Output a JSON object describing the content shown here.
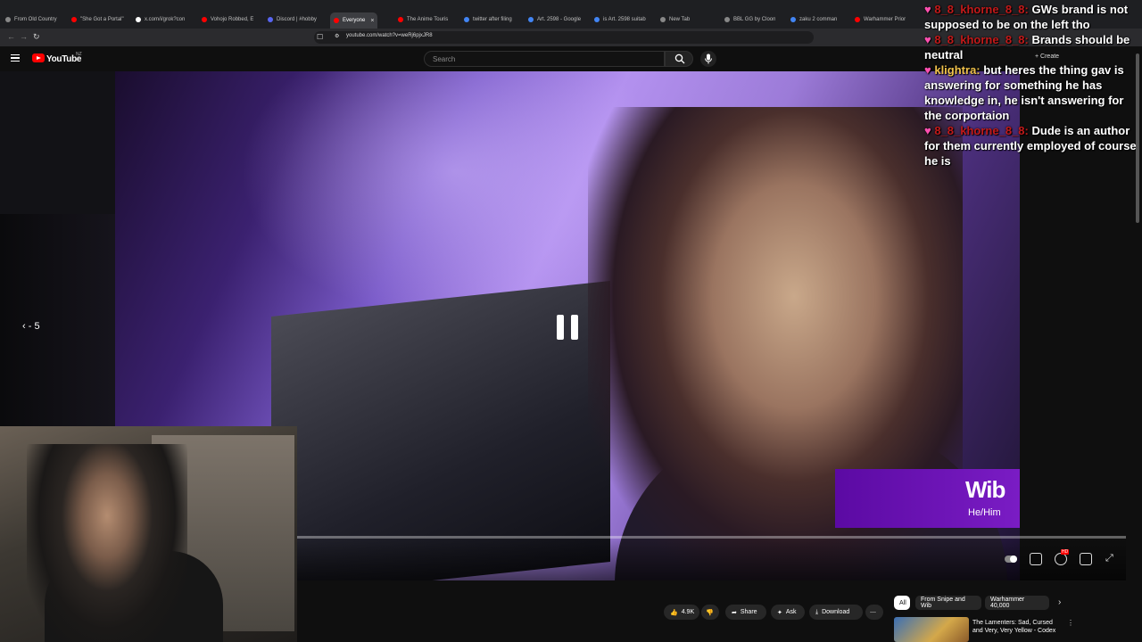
{
  "browser": {
    "tabs": [
      {
        "label": "From Old Country",
        "color": "#888888"
      },
      {
        "label": "\"She Got a Portal\"",
        "color": "#ff0000"
      },
      {
        "label": "x.com/i/grok?con",
        "color": "#ffffff"
      },
      {
        "label": "Vohojo Robbed, E",
        "color": "#ff0000"
      },
      {
        "label": "Discord | #hobby",
        "color": "#5865f2"
      },
      {
        "label": "Everyone",
        "color": "#ff0000",
        "active": true
      },
      {
        "label": "The Anime Touris",
        "color": "#ff0000"
      },
      {
        "label": "twitter after filing",
        "color": "#4285f4"
      },
      {
        "label": "Art. 2598 - Google",
        "color": "#4285f4"
      },
      {
        "label": "is Art. 2598 suitab",
        "color": "#4285f4"
      },
      {
        "label": "New Tab",
        "color": "#888888"
      },
      {
        "label": "BBL GG by Cloon",
        "color": "#888888"
      },
      {
        "label": "zaku 2 comman",
        "color": "#4285f4"
      },
      {
        "label": "Warhammer Prior",
        "color": "#ff0000"
      }
    ],
    "url": "youtube.com/watch?v=weRj6pjxJR8"
  },
  "header": {
    "wordmark": "YouTube",
    "country": "NZ",
    "search_placeholder": "Search",
    "create_label": "Create"
  },
  "player": {
    "seek_label": "- 5",
    "nameplate_name": "Wib",
    "nameplate_pronouns": "He/Him",
    "progress_fraction": 0.0
  },
  "chat": {
    "messages": [
      {
        "user": "8_8_khorne_8_8:",
        "user_color": "#c21a1a",
        "text": "GWs brand is not supposed to be on the left tho"
      },
      {
        "user": "8_8_khorne_8_8:",
        "user_color": "#c21a1a",
        "text": "Brands should be neutral"
      },
      {
        "user": "klightra:",
        "user_color": "#f0c24b",
        "text": "but heres the thing gav is answering for something he has knowledge in, he isn't answering for the corportaion"
      },
      {
        "user": "8_8_khorne_8_8:",
        "user_color": "#c21a1a",
        "text": "Dude is an author for them currently employed of course he is"
      }
    ]
  },
  "actions": {
    "like_count": "4.9K",
    "share_label": "Share",
    "ask_label": "Ask",
    "download_label": "Download"
  },
  "chips": [
    {
      "label": "All",
      "active": true
    },
    {
      "label": "From Snipe and Wib",
      "active": false
    },
    {
      "label": "Warhammer 40,000",
      "active": false
    }
  ],
  "recommended": {
    "title": "The Lamenters: Sad, Cursed and Very, Very Yellow - Codex"
  }
}
